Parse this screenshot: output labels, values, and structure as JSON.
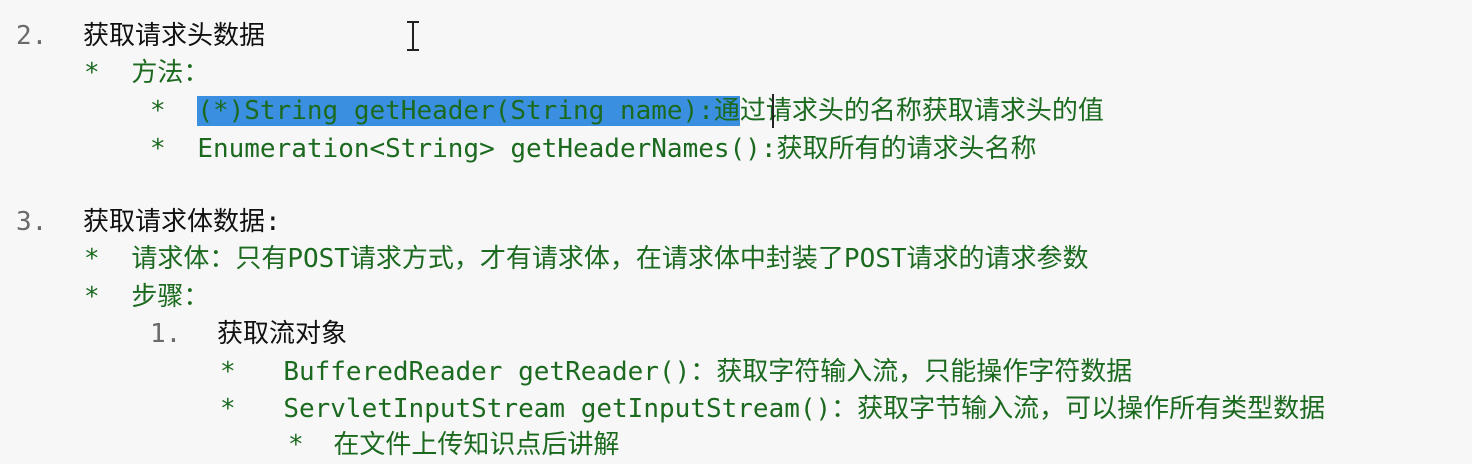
{
  "section2": {
    "num": "2.",
    "title": "获取请求头数据",
    "method_bullet": "*",
    "method_label": "方法：",
    "items": [
      {
        "bullet": "*",
        "selected": "(*)String getHeader(String name):通",
        "rest": "过请求头的名称获取请求头的值"
      },
      {
        "bullet": "*",
        "text": "Enumeration<String> getHeaderNames():获取所有的请求头名称"
      }
    ]
  },
  "section3": {
    "num": "3.",
    "title": "获取请求体数据:",
    "body_bullet": "*",
    "body_text": "请求体：只有POST请求方式，才有请求体，在请求体中封装了POST请求的请求参数",
    "steps_bullet": "*",
    "steps_label": "步骤：",
    "step1_num": "1.",
    "step1_title": "获取流对象",
    "stream_items": [
      {
        "bullet": "*",
        "text": "BufferedReader getReader()：获取字符输入流，只能操作字符数据"
      },
      {
        "bullet": "*",
        "text": "ServletInputStream getInputStream()：获取字节输入流，可以操作所有类型数据"
      }
    ],
    "note_bullet": "*",
    "note_text": "在文件上传知识点后讲解"
  }
}
